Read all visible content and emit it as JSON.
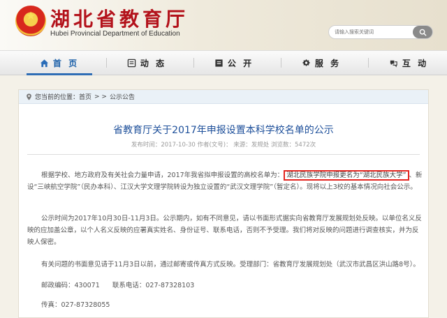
{
  "header": {
    "title": "湖北省教育厅",
    "subtitle": "Hubei Provincial Department of Education",
    "search_placeholder": "请输入搜索关键词"
  },
  "nav": {
    "items": [
      {
        "label": "首 页",
        "icon": "home-icon",
        "active": true
      },
      {
        "label": "动 态",
        "icon": "news-icon",
        "active": false
      },
      {
        "label": "公 开",
        "icon": "list-icon",
        "active": false
      },
      {
        "label": "服 务",
        "icon": "service-icon",
        "active": false
      },
      {
        "label": "互 动",
        "icon": "interact-icon",
        "active": false
      }
    ]
  },
  "breadcrumb": {
    "prefix": "您当前的位置：",
    "home": "首页",
    "sep1": "> >",
    "section": "公示公告"
  },
  "article": {
    "title": "省教育厅关于2017年申报设置本科学校名单的公示",
    "meta": "发布时间：2017-10-30 作者(文号)： 来源：发规处 浏览数：5472次",
    "p1_before": "根据学校、地方政府及有关社会力量申请，2017年我省拟申报设置的高校名单为：",
    "p1_highlight": "湖北民族学院申报更名为“湖北民族大学”",
    "p1_after": "、新设“三峡航空学院”（民办本科）、江汉大学文理学院转设为独立设置的“武汉文理学院”（暂定名）。现将以上3校的基本情况向社会公示。",
    "p2": "公示时间为2017年10月30日-11月3日。公示期内，如有不同意见，请以书面形式据实向省教育厅发展规划处反映。以单位名义反映的应加盖公章，以个人名义反映的应署真实姓名、身份证号、联系电话，否则不予受理。我们将对反映的问题进行调查核实，并为反映人保密。",
    "p3": "有关问题的书面意见请于11月3日以前，通过邮寄或传真方式反映。受理部门：省教育厅发展规划处（武汉市武昌区洪山路8号）。",
    "p4": "邮政编码：430071      联系电话：027-87328103",
    "p5": "传真：027-87328055"
  },
  "colors": {
    "brand_red": "#b3121b",
    "title_blue": "#1d4f9a",
    "highlight_border": "#e3251f"
  }
}
